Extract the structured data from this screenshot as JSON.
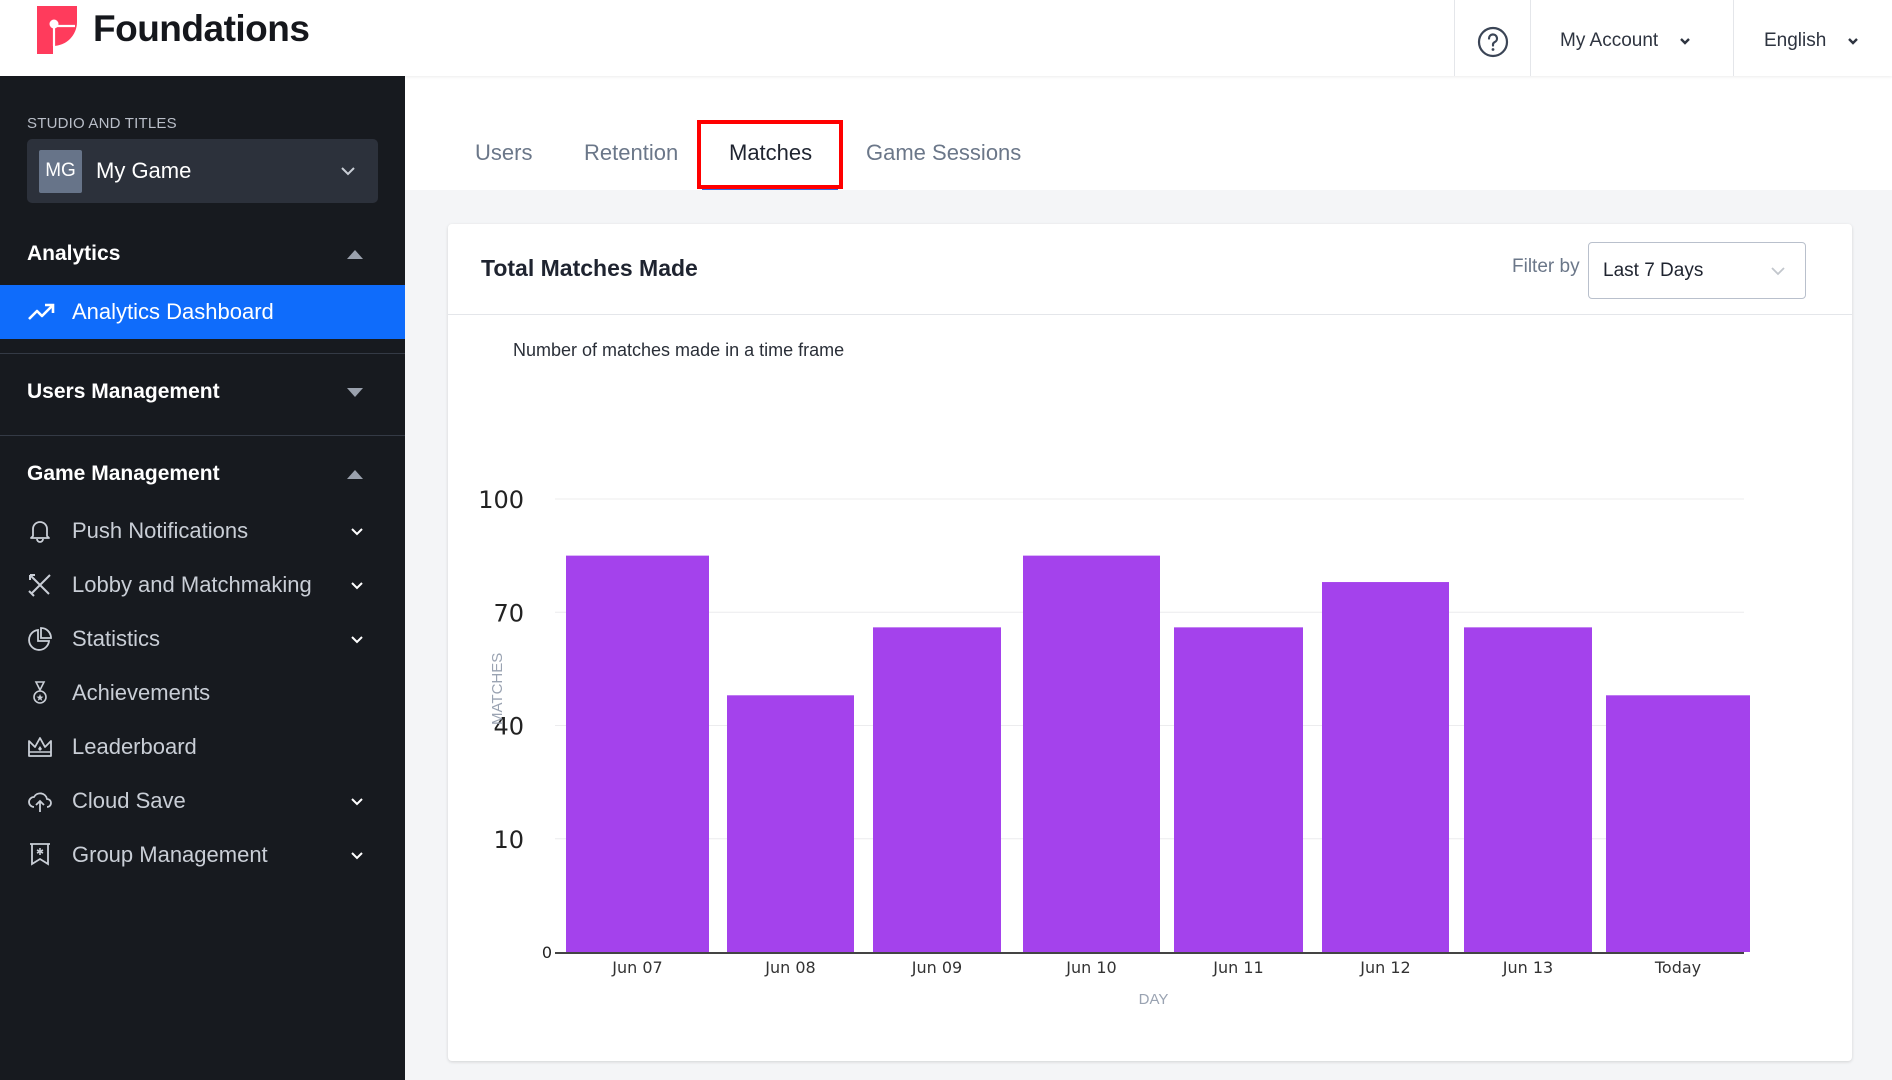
{
  "header": {
    "brand": "Foundations",
    "help_icon": "question-circle-icon",
    "account_label": "My Account",
    "language_label": "English"
  },
  "sidebar": {
    "studio_label": "STUDIO AND TITLES",
    "game_badge": "MG",
    "game_name": "My Game",
    "sections": {
      "analytics": {
        "label": "Analytics",
        "expanded": true
      },
      "users_management": {
        "label": "Users Management",
        "expanded": false
      },
      "game_management": {
        "label": "Game Management",
        "expanded": true
      }
    },
    "active_item": {
      "label": "Analytics Dashboard",
      "icon": "trending-up-icon"
    },
    "game_items": [
      {
        "label": "Push Notifications",
        "icon": "bell-icon",
        "has_submenu": true
      },
      {
        "label": "Lobby and Matchmaking",
        "icon": "crossed-swords-icon",
        "has_submenu": true
      },
      {
        "label": "Statistics",
        "icon": "pie-chart-icon",
        "has_submenu": true
      },
      {
        "label": "Achievements",
        "icon": "medal-icon",
        "has_submenu": false
      },
      {
        "label": "Leaderboard",
        "icon": "crown-icon",
        "has_submenu": false
      },
      {
        "label": "Cloud Save",
        "icon": "cloud-upload-icon",
        "has_submenu": true
      },
      {
        "label": "Group Management",
        "icon": "group-banner-icon",
        "has_submenu": true
      }
    ]
  },
  "tabs": [
    {
      "label": "Users",
      "active": false
    },
    {
      "label": "Retention",
      "active": false
    },
    {
      "label": "Matches",
      "active": true
    },
    {
      "label": "Game Sessions",
      "active": false
    }
  ],
  "card": {
    "title": "Total Matches Made",
    "filter_label": "Filter by",
    "filter_value": "Last 7 Days"
  },
  "colors": {
    "accent": "#0f6cfb",
    "bar": "#a442ec",
    "brand_red": "#ff3b5c",
    "highlight": "#ff0000"
  },
  "chart_data": {
    "type": "bar",
    "title": "Number of matches made in a time frame",
    "xlabel": "DAY",
    "ylabel": "MATCHES",
    "categories": [
      "Jun 07",
      "Jun 08",
      "Jun 09",
      "Jun 10",
      "Jun 11",
      "Jun 12",
      "Jun 13",
      "Today"
    ],
    "values": [
      85,
      48,
      66,
      85,
      66,
      78,
      66,
      48
    ],
    "y_ticks": [
      0,
      10,
      40,
      70,
      100
    ],
    "ylim": [
      0,
      100
    ],
    "grid": true,
    "legend": "none"
  }
}
